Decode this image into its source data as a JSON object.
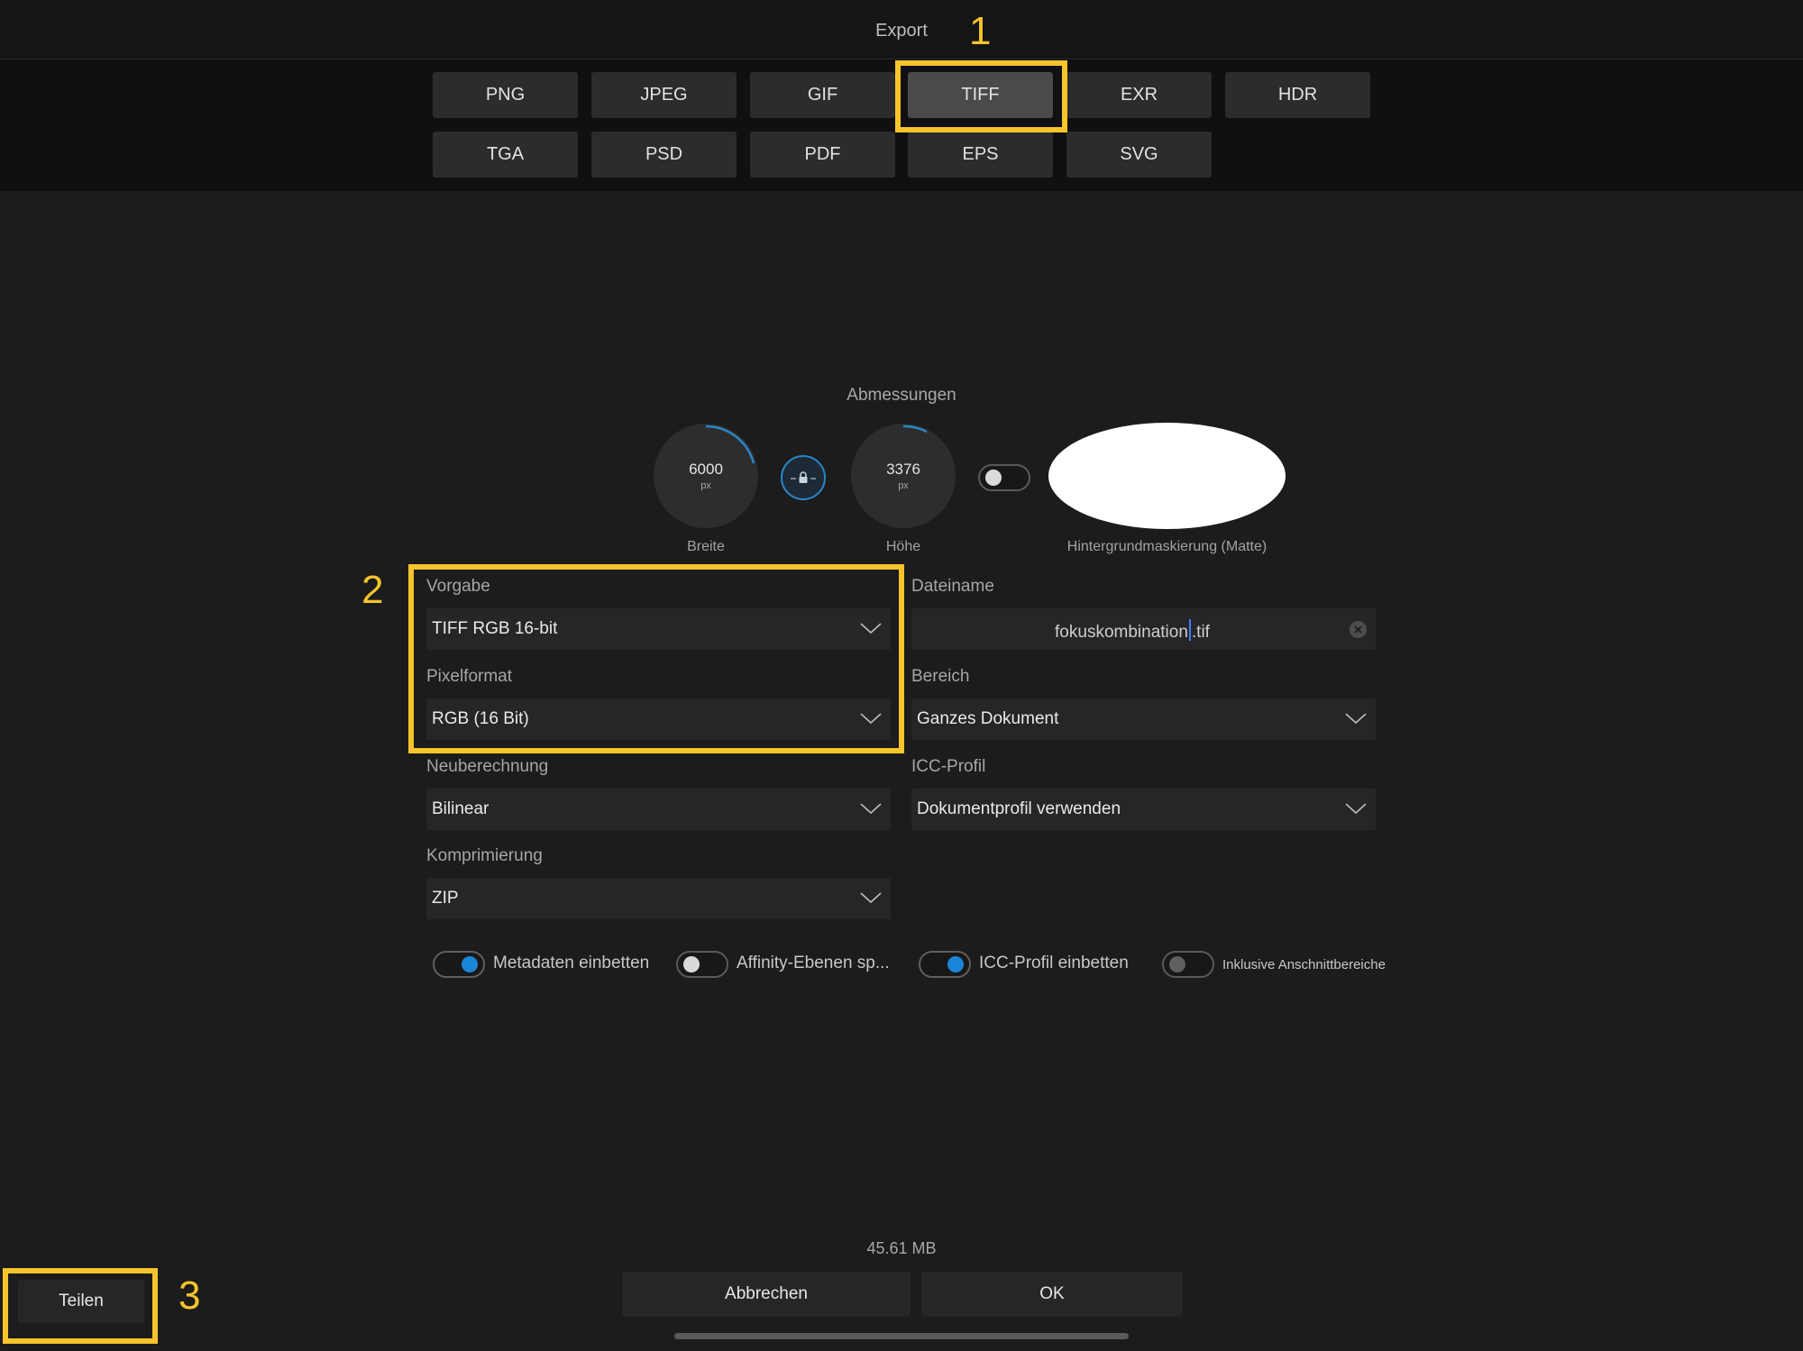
{
  "window": {
    "title": "Export"
  },
  "formats": {
    "row1": [
      "PNG",
      "JPEG",
      "GIF",
      "TIFF",
      "EXR",
      "HDR"
    ],
    "row2": [
      "TGA",
      "PSD",
      "PDF",
      "EPS",
      "SVG"
    ],
    "selected": "TIFF"
  },
  "annotations": {
    "marker1": "1",
    "marker2": "2",
    "marker3": "3",
    "highlight_color": "#f6c42c"
  },
  "dimensions": {
    "heading": "Abmessungen",
    "width": {
      "value": "6000",
      "unit": "px",
      "label": "Breite"
    },
    "height": {
      "value": "3376",
      "unit": "px",
      "label": "Höhe"
    },
    "aspect_lock": "on",
    "matte": {
      "label": "Hintergrundmaskierung (Matte)",
      "enabled": false,
      "color": "#ffffff"
    }
  },
  "settings": {
    "preset": {
      "label": "Vorgabe",
      "value": "TIFF RGB 16-bit"
    },
    "pixel_format": {
      "label": "Pixelformat",
      "value": "RGB (16 Bit)"
    },
    "resample": {
      "label": "Neuberechnung",
      "value": "Bilinear"
    },
    "compression": {
      "label": "Komprimierung",
      "value": "ZIP"
    },
    "filename": {
      "label": "Dateiname",
      "before_caret": "fokuskombination",
      "after_caret": ".tif"
    },
    "area": {
      "label": "Bereich",
      "value": "Ganzes Dokument"
    },
    "icc": {
      "label": "ICC-Profil",
      "value": "Dokumentprofil verwenden"
    }
  },
  "options": [
    {
      "label": "Metadaten einbetten",
      "on": true
    },
    {
      "label": "Affinity-Ebenen sp...",
      "on": false
    },
    {
      "label": "ICC-Profil einbetten",
      "on": true
    },
    {
      "label": "Inklusive Anschnittbereiche",
      "on": false
    }
  ],
  "footer": {
    "file_size": "45.61 MB",
    "cancel": "Abbrechen",
    "ok": "OK",
    "share": "Teilen"
  },
  "colors": {
    "accent": "#1b86d8",
    "background": "#1c1c1c"
  }
}
